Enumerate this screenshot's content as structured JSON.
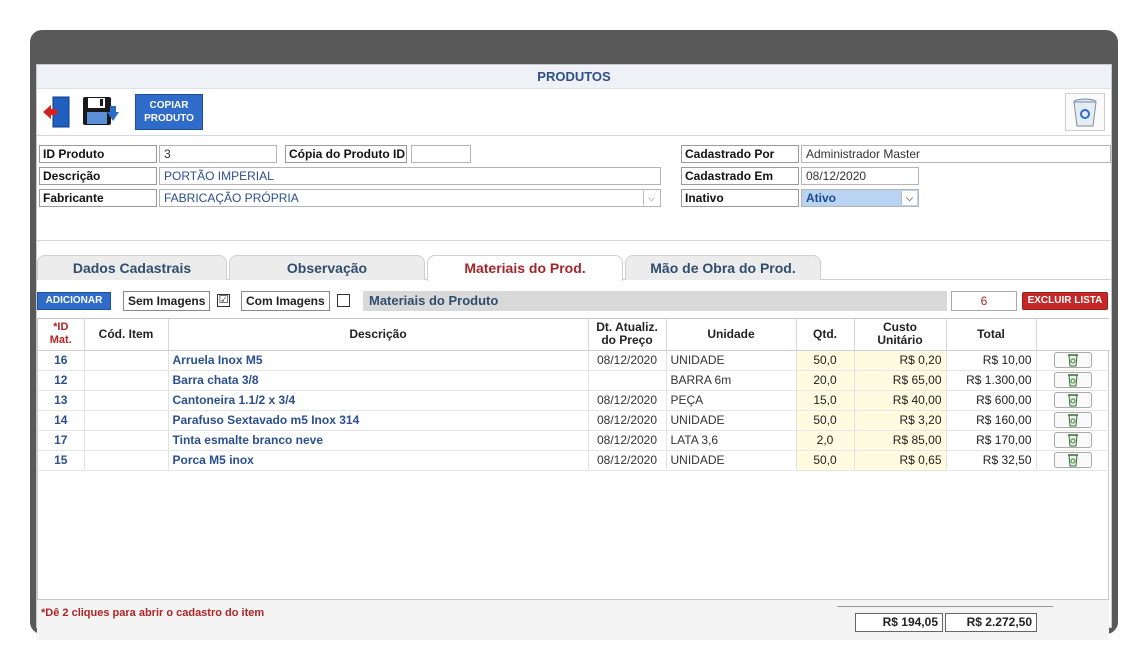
{
  "window": {
    "title": "PRODUTOS"
  },
  "toolbar": {
    "exit_icon": "exit-door-icon",
    "save_icon": "save-disk-icon",
    "copy_label": "COPIAR PRODUTO",
    "trash_icon": "recycle-bin-icon"
  },
  "form": {
    "id_produto_label": "ID Produto",
    "id_produto_value": "3",
    "copia_label": "Cópia do Produto ID",
    "copia_value": "",
    "descricao_label": "Descrição",
    "descricao_value": "PORTÃO IMPERIAL",
    "fabricante_label": "Fabricante",
    "fabricante_value": "FABRICAÇÃO PRÓPRIA",
    "cadastrado_por_label": "Cadastrado Por",
    "cadastrado_por_value": "Administrador Master",
    "cadastrado_em_label": "Cadastrado Em",
    "cadastrado_em_value": "08/12/2020",
    "inativo_label": "Inativo",
    "inativo_value": "Ativo"
  },
  "tabs": [
    {
      "label": "Dados Cadastrais",
      "active": false
    },
    {
      "label": "Observação",
      "active": false
    },
    {
      "label": "Materiais do Prod.",
      "active": true
    },
    {
      "label": "Mão de Obra do Prod.",
      "active": false
    }
  ],
  "materials": {
    "add_label": "ADICIONAR",
    "sem_imagens_label": "Sem Imagens",
    "sem_imagens_checked": "☑",
    "com_imagens_label": "Com Imagens",
    "section_title": "Materiais do Produto",
    "count": "6",
    "delete_list_label": "EXCLUIR LISTA",
    "columns": {
      "id_line1": "*ID",
      "id_line2": "Mat.",
      "cod": "Cód. Item",
      "desc": "Descrição",
      "date_line1": "Dt. Atualiz.",
      "date_line2": "do Preço",
      "unidade": "Unidade",
      "qtd": "Qtd.",
      "custo_line1": "Custo",
      "custo_line2": "Unitário",
      "total": "Total"
    },
    "rows": [
      {
        "id": "16",
        "cod": "",
        "desc": "Arruela Inox M5",
        "date": "08/12/2020",
        "unidade": "UNIDADE",
        "qtd": "50,0",
        "custo": "R$ 0,20",
        "total": "R$ 10,00"
      },
      {
        "id": "12",
        "cod": "",
        "desc": "Barra chata 3/8",
        "date": "",
        "unidade": "BARRA 6m",
        "qtd": "20,0",
        "custo": "R$ 65,00",
        "total": "R$ 1.300,00"
      },
      {
        "id": "13",
        "cod": "",
        "desc": "Cantoneira 1.1/2 x 3/4",
        "date": "08/12/2020",
        "unidade": "PEÇA",
        "qtd": "15,0",
        "custo": "R$ 40,00",
        "total": "R$ 600,00"
      },
      {
        "id": "14",
        "cod": "",
        "desc": "Parafuso Sextavado m5 Inox 314",
        "date": "08/12/2020",
        "unidade": "UNIDADE",
        "qtd": "50,0",
        "custo": "R$ 3,20",
        "total": "R$ 160,00"
      },
      {
        "id": "17",
        "cod": "",
        "desc": "Tinta esmalte branco neve",
        "date": "08/12/2020",
        "unidade": "LATA 3,6",
        "qtd": "2,0",
        "custo": "R$ 85,00",
        "total": "R$ 170,00"
      },
      {
        "id": "15",
        "cod": "",
        "desc": "Porca M5 inox",
        "date": "08/12/2020",
        "unidade": "UNIDADE",
        "qtd": "50,0",
        "custo": "R$ 0,65",
        "total": "R$ 32,50"
      }
    ],
    "row_delete_icon": "recycle-bin-icon",
    "hint": "*Dê 2 cliques para abrir o cadastro do item",
    "total_custo": "R$ 194,05",
    "total_geral": "R$ 2.272,50"
  }
}
